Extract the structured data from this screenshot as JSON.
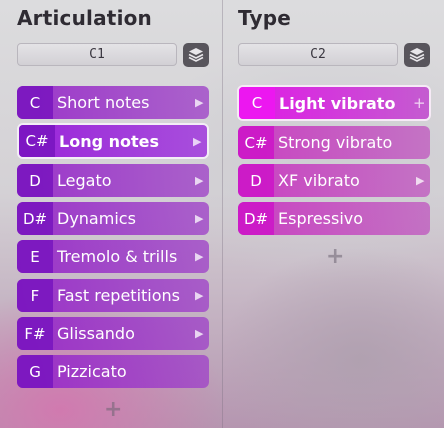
{
  "articulation": {
    "title": "Articulation",
    "selector": "C1",
    "items": [
      {
        "key": "C",
        "label": "Short notes",
        "submenu": true
      },
      {
        "key": "C#",
        "label": "Long notes",
        "submenu": true
      },
      {
        "key": "D",
        "label": "Legato",
        "submenu": true
      },
      {
        "key": "D#",
        "label": "Dynamics",
        "submenu": true
      },
      {
        "key": "E",
        "label": "Tremolo & trills",
        "submenu": true
      },
      {
        "key": "F",
        "label": "Fast repetitions",
        "submenu": true
      },
      {
        "key": "F#",
        "label": "Glissando",
        "submenu": true
      },
      {
        "key": "G",
        "label": "Pizzicato",
        "submenu": false
      }
    ],
    "add_label": "+"
  },
  "type": {
    "title": "Type",
    "selector": "C2",
    "items": [
      {
        "key": "C",
        "label": "Light vibrato",
        "trailing": "+"
      },
      {
        "key": "C#",
        "label": "Strong vibrato",
        "trailing": ""
      },
      {
        "key": "D",
        "label": "XF vibrato",
        "trailing": "›"
      },
      {
        "key": "D#",
        "label": "Espressivo",
        "trailing": ""
      }
    ],
    "add_label": "+"
  },
  "icons": {
    "layers": "layers-icon",
    "chevron": "chevron-right-icon",
    "add": "plus-icon"
  },
  "colors": {
    "articulation_item": "#9a24d9",
    "type_active": "#ec17f0",
    "type_item": "#c830be"
  }
}
